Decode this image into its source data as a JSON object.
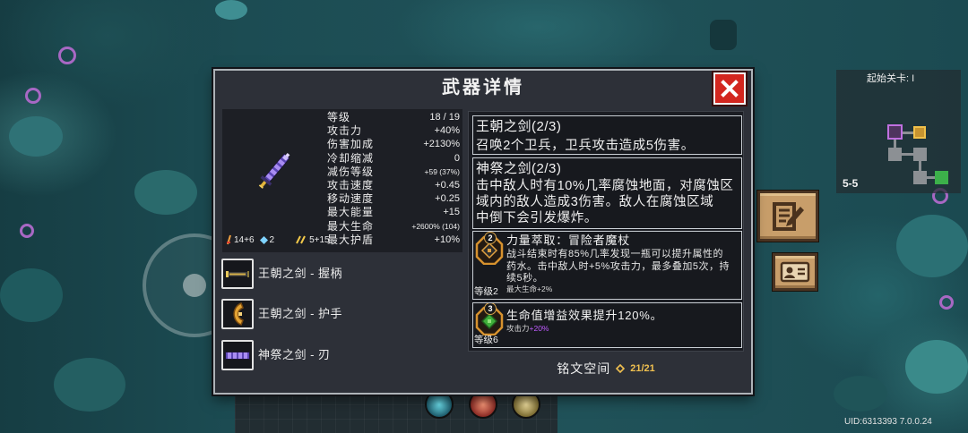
{
  "dialog": {
    "title": "武器详情",
    "close_icon": "close-x-icon"
  },
  "weapon": {
    "sprite_icon": "purple-sword-icon",
    "stats": [
      {
        "label": "等级",
        "value": "18 / 19"
      },
      {
        "label": "攻击力",
        "value": "+40%"
      },
      {
        "label": "伤害加成",
        "value": "+2130%"
      },
      {
        "label": "冷却缩减",
        "value": "0"
      },
      {
        "label": "减伤等级",
        "value": "+59 (37%)"
      },
      {
        "label": "攻击速度",
        "value": "+0.45"
      },
      {
        "label": "移动速度",
        "value": "+0.25"
      },
      {
        "label": "最大能量",
        "value": "+15"
      },
      {
        "label": "最大生命",
        "value": "+2600% (104)"
      },
      {
        "label": "最大护盾",
        "value": "+10%"
      }
    ],
    "footer": [
      {
        "icon": "sword-power-icon",
        "text": "14+6"
      },
      {
        "icon": "crystal-icon",
        "text": "2"
      },
      {
        "icon": "energy-streak-icon",
        "text": "5+15"
      }
    ]
  },
  "parts": [
    {
      "icon": "sword-hilt-icon",
      "label": "王朝之剑 - 握柄"
    },
    {
      "icon": "sword-guard-icon",
      "label": "王朝之剑 - 护手"
    },
    {
      "icon": "sword-blade-icon",
      "label": "神祭之剑 - 刃"
    }
  ],
  "set_bonuses": [
    {
      "title": "王朝之剑(2/3)",
      "lines": [
        "召唤2个卫兵，卫兵攻击造成5伤害。"
      ]
    },
    {
      "title": "神祭之剑(2/3)",
      "lines": [
        "击中敌人时有10%几率腐蚀地面，对腐蚀区",
        "域内的敌人造成3伤害。敌人在腐蚀区域",
        "中倒下会引发爆炸。"
      ]
    }
  ],
  "inscriptions": [
    {
      "icon": "inscription-rune-icon",
      "badge": "2",
      "level": "等级2",
      "title": "力量萃取：冒险者魔杖",
      "lines": [
        "战斗结束时有85%几率发现一瓶可以提升属性的",
        "药水。击中敌人时+5%攻击力，最多叠加5次，持",
        "续5秒。"
      ],
      "extra": "最大生命+2%"
    },
    {
      "icon": "inscription-rune-icon",
      "badge": "3",
      "level": "等级6",
      "title": "生命值增益效果提升120%。",
      "extra_label": "攻击力",
      "extra_value": "+20%"
    }
  ],
  "inscription_space": {
    "label": "铭文空间",
    "icon": "gold-diamond-icon",
    "value": "21/21"
  },
  "side_buttons": [
    {
      "icon": "notepad-edit-icon"
    },
    {
      "icon": "id-card-icon"
    }
  ],
  "minimap": {
    "title": "起始关卡: I",
    "stage": "5-5"
  },
  "uid": "UID:6313393 7.0.0.24",
  "colors": {
    "accent_gold": "#f0c050",
    "bonus_purple": "#c05cff",
    "close_red": "#d3261f"
  }
}
